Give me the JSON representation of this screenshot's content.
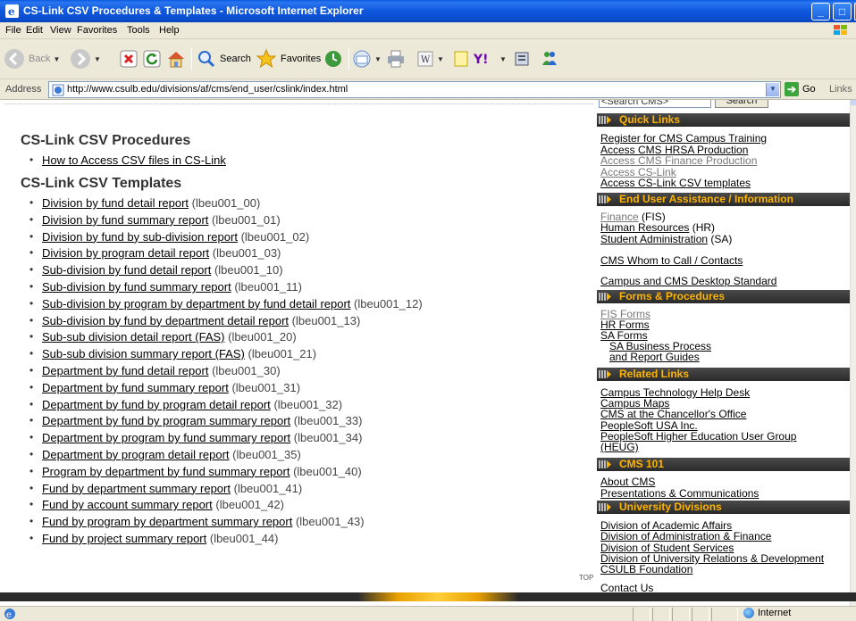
{
  "window": {
    "title": "CS-Link CSV Procedures & Templates - Microsoft Internet Explorer"
  },
  "menu": [
    "File",
    "Edit",
    "View",
    "Favorites",
    "Tools",
    "Help"
  ],
  "toolbar": {
    "back": "Back",
    "search": "Search",
    "favorites": "Favorites"
  },
  "address": {
    "label": "Address",
    "url": "http://www.csulb.edu/divisions/af/cms/end_user/cslink/index.html",
    "go": "Go",
    "links": "Links"
  },
  "main": {
    "procedures_heading": "CS-Link CSV Procedures",
    "procedures": [
      {
        "label": "How to Access CSV files in CS-Link",
        "code": ""
      }
    ],
    "templates_heading": "CS-Link CSV Templates",
    "templates": [
      {
        "label": "Division by fund detail report",
        "code": "(lbeu001_00)"
      },
      {
        "label": "Division by fund summary report",
        "code": "(lbeu001_01)"
      },
      {
        "label": "Division by fund by sub-division report",
        "code": "(lbeu001_02)"
      },
      {
        "label": "Division by program detail report",
        "code": "(lbeu001_03)"
      },
      {
        "label": "Sub-division by fund detail report",
        "code": "(lbeu001_10)"
      },
      {
        "label": "Sub-division by fund summary report",
        "code": "(lbeu001_11)"
      },
      {
        "label": "Sub-division by program by department by fund detail report",
        "code": "(lbeu001_12)"
      },
      {
        "label": "Sub-division by fund by department detail report",
        "code": "(lbeu001_13)"
      },
      {
        "label": "Sub-sub division detail report (FAS)",
        "code": "(lbeu001_20)"
      },
      {
        "label": "Sub-sub division summary report (FAS)",
        "code": "(lbeu001_21)"
      },
      {
        "label": "Department by fund detail report",
        "code": "(lbeu001_30)"
      },
      {
        "label": "Department by fund summary report",
        "code": "(lbeu001_31)"
      },
      {
        "label": "Department by fund by program detail report",
        "code": "(lbeu001_32)"
      },
      {
        "label": "Department by fund by program summary report",
        "code": "(lbeu001_33)"
      },
      {
        "label": "Department by program by fund summary report",
        "code": "(lbeu001_34)"
      },
      {
        "label": "Department by program detail report",
        "code": "(lbeu001_35)"
      },
      {
        "label": "Program by department by fund summary report",
        "code": "(lbeu001_40)"
      },
      {
        "label": "Fund by department summary report",
        "code": "(lbeu001_41)"
      },
      {
        "label": "Fund by account summary report",
        "code": "(lbeu001_42)"
      },
      {
        "label": "Fund by program by department summary report",
        "code": "(lbeu001_43)"
      },
      {
        "label": "Fund by project summary report",
        "code": "(lbeu001_44)"
      }
    ],
    "top_link": "TOP"
  },
  "sidebar": {
    "search_placeholder": "<Search CMS>",
    "search_button": "Search",
    "quick_links": {
      "heading": "Quick Links",
      "items": [
        {
          "label": "Register for CMS Campus Training"
        },
        {
          "label": "Access CMS HRSA Production"
        },
        {
          "label": "Access CMS Finance Production"
        },
        {
          "label": "Access CS-Link"
        },
        {
          "label": "Access CS-Link CSV templates"
        }
      ]
    },
    "assistance": {
      "heading": "End User Assistance / Information",
      "items": [
        {
          "label": "Finance",
          "suffix": " (FIS)"
        },
        {
          "label": "Human Resources",
          "suffix": " (HR)"
        },
        {
          "label": "Student Administration",
          "suffix": " (SA)"
        },
        {
          "label": "CMS Whom to Call / Contacts",
          "suffix": ""
        },
        {
          "label": "Campus and CMS Desktop Standard",
          "suffix": ""
        }
      ]
    },
    "forms": {
      "heading": "Forms & Procedures",
      "items": [
        {
          "label": "FIS Forms"
        },
        {
          "label": "HR Forms"
        },
        {
          "label": "SA Forms"
        },
        {
          "label": "SA Business Process"
        },
        {
          "label": "and Report Guides"
        }
      ]
    },
    "related": {
      "heading": "Related Links",
      "items": [
        {
          "label": "Campus Technology Help Desk"
        },
        {
          "label": "Campus Maps"
        },
        {
          "label": "CMS at the Chancellor's Office"
        },
        {
          "label": "PeopleSoft USA Inc."
        },
        {
          "label": "PeopleSoft Higher Education User Group"
        },
        {
          "label": "(HEUG)"
        }
      ]
    },
    "cms101": {
      "heading": "CMS 101",
      "items": [
        {
          "label": "About CMS"
        },
        {
          "label": "Presentations & Communications"
        }
      ]
    },
    "divisions": {
      "heading": "University Divisions",
      "items": [
        {
          "label": "Division of Academic Affairs"
        },
        {
          "label": "Division of Administration & Finance"
        },
        {
          "label": "Division of Student Services"
        },
        {
          "label": "Division of University Relations & Development"
        },
        {
          "label": "CSULB Foundation"
        }
      ]
    },
    "contact": "Contact Us"
  },
  "status": {
    "zone": "Internet"
  },
  "colors": {
    "section_heading_text": "#ffb400",
    "section_heading_bg": "#2f2f2f"
  }
}
